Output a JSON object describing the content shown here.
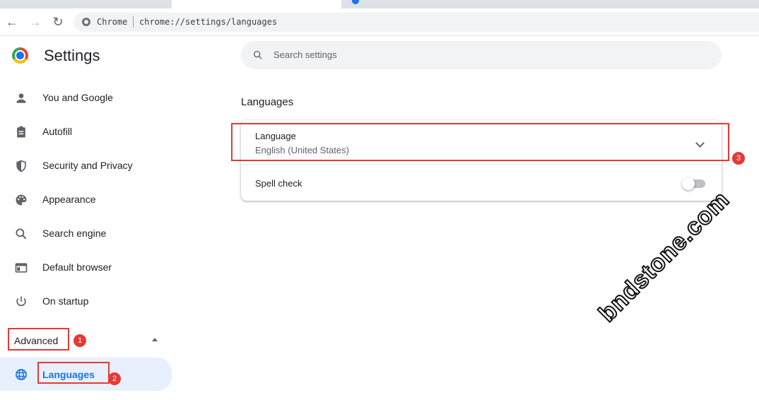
{
  "browser": {
    "chip_label": "Chrome",
    "url": "chrome://settings/languages"
  },
  "header": {
    "title": "Settings",
    "search_placeholder": "Search settings"
  },
  "sidebar": {
    "items": [
      {
        "label": "You and Google",
        "icon": "person-icon"
      },
      {
        "label": "Autofill",
        "icon": "clipboard-icon"
      },
      {
        "label": "Security and Privacy",
        "icon": "shield-icon"
      },
      {
        "label": "Appearance",
        "icon": "palette-icon"
      },
      {
        "label": "Search engine",
        "icon": "search-icon"
      },
      {
        "label": "Default browser",
        "icon": "browser-window-icon"
      },
      {
        "label": "On startup",
        "icon": "power-icon"
      }
    ],
    "advanced_label": "Advanced",
    "languages_label": "Languages"
  },
  "main": {
    "section_title": "Languages",
    "language_label": "Language",
    "language_value": "English (United States)",
    "spell_check_label": "Spell check",
    "spell_check_on": false
  },
  "annotations": [
    "1",
    "2",
    "3"
  ],
  "watermark": "bndstone.com",
  "colors": {
    "accent": "#1a73e8",
    "annotation": "#e53935"
  }
}
